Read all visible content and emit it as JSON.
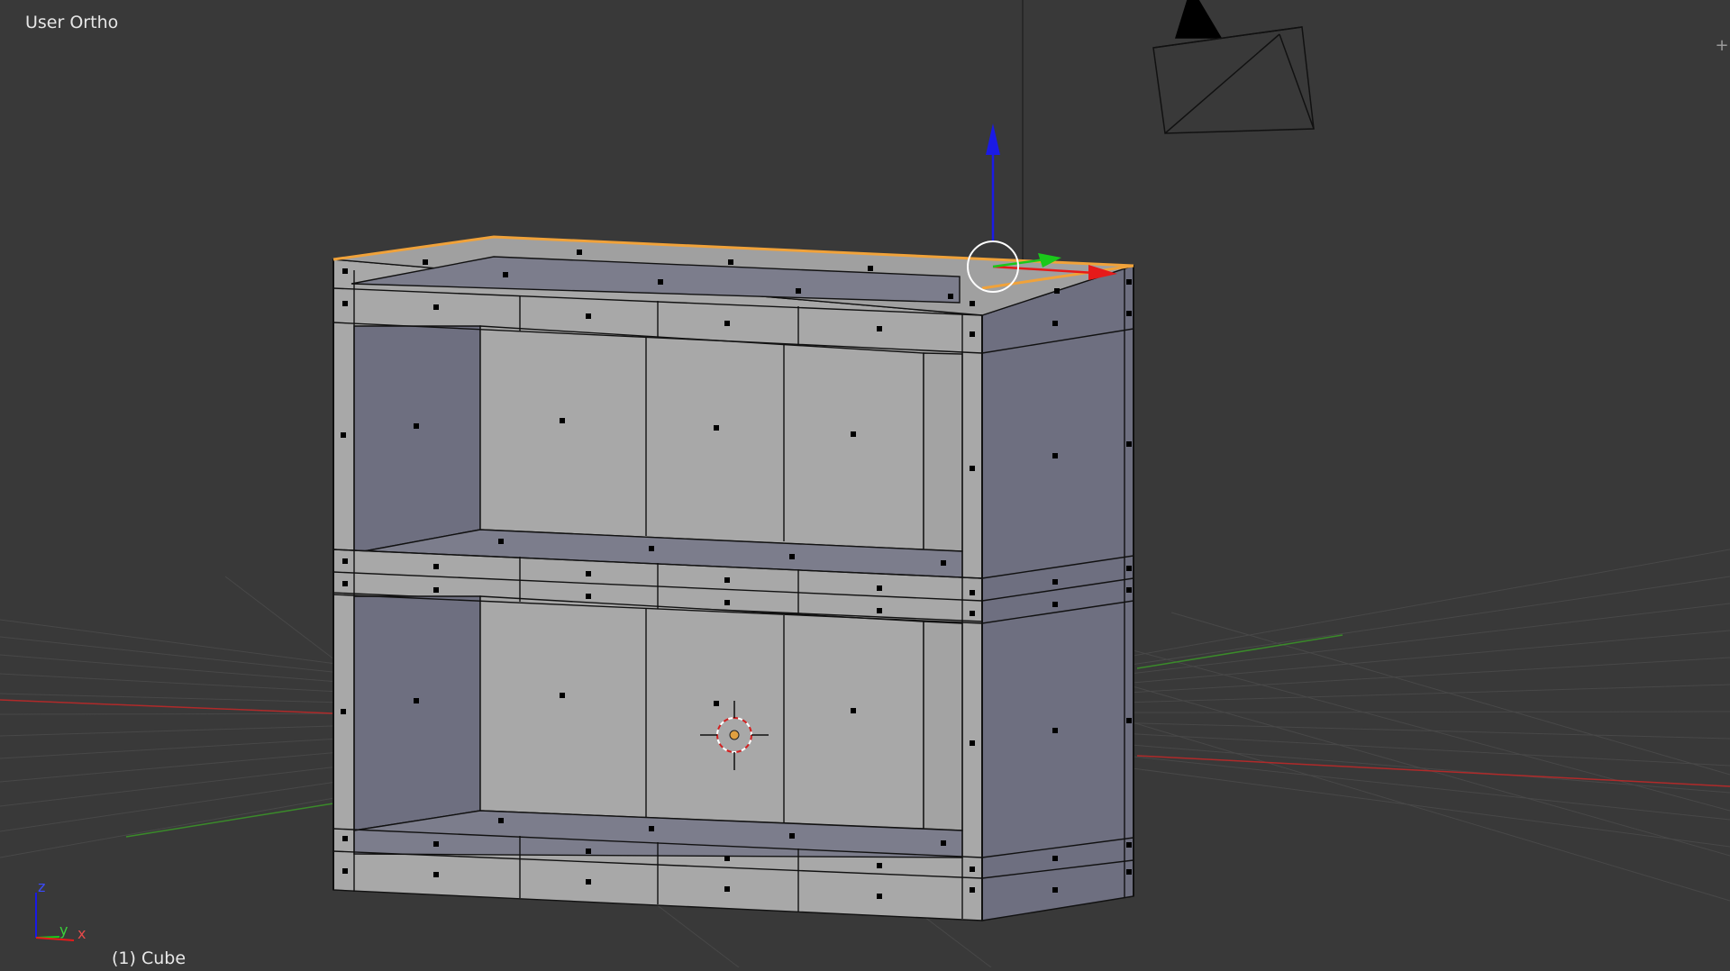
{
  "viewport": {
    "view_name": "User Ortho",
    "active_object": "(1) Cube",
    "corner_widget_glyph": "+"
  },
  "axes_gizmo": {
    "z_label": "z",
    "y_label": "y",
    "x_label": "x"
  },
  "colors": {
    "background": "#393939",
    "grid": "#4a4a4a",
    "x_axis": "#b02a2a",
    "y_axis": "#3a8a2a",
    "selected_edge": "#f0a23a",
    "mesh_light": "#a8a8a8",
    "mesh_dark": "#6e6f80",
    "manipulator_z": "#1a1ae6",
    "manipulator_x": "#e61a1a",
    "manipulator_y": "#1ac81a"
  },
  "icons": {
    "camera": "camera-icon",
    "cursor": "3d-cursor-icon",
    "transform": "transform-manipulator-icon",
    "origin": "object-origin-icon"
  }
}
